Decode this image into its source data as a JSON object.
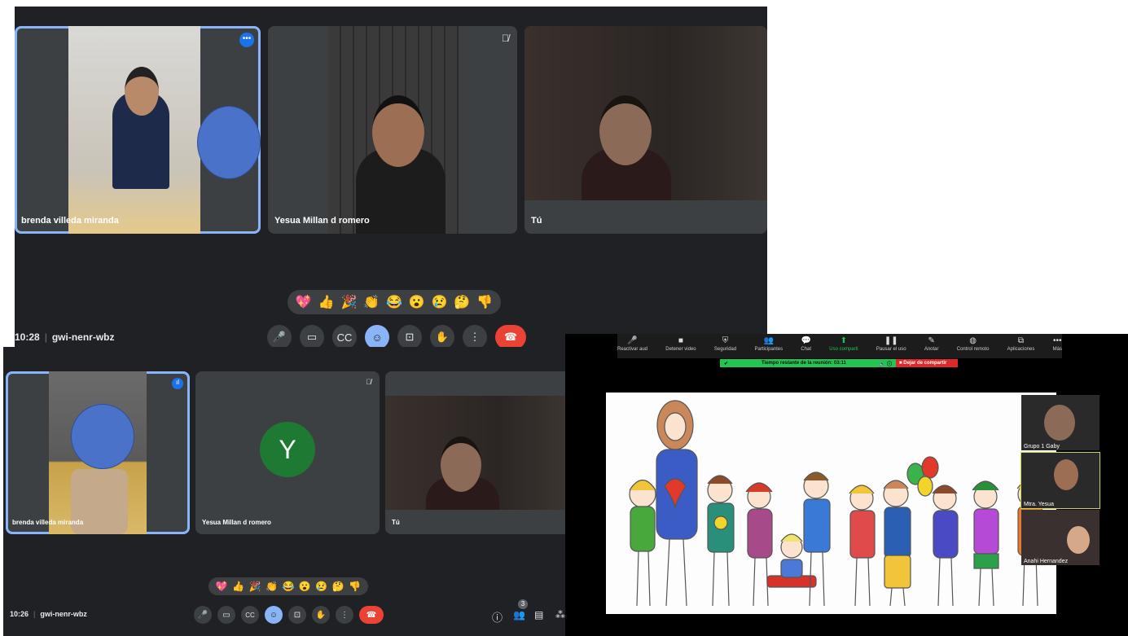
{
  "meet_top": {
    "meeting_time": "10:28",
    "meeting_code": "gwi-nenr-wbz",
    "participants": [
      {
        "name": "brenda villeda miranda"
      },
      {
        "name": "Yesua Millan d romero"
      },
      {
        "name": "Tú"
      }
    ],
    "emojis": [
      "💖",
      "👍",
      "🎉",
      "👏",
      "😂",
      "😮",
      "😢",
      "🤔",
      "👎"
    ]
  },
  "meet_bottom": {
    "meeting_time": "10:26",
    "meeting_code": "gwi-nenr-wbz",
    "participants": [
      {
        "name": "brenda villeda miranda"
      },
      {
        "name": "Yesua Millan d romero",
        "initial": "Y"
      },
      {
        "name": "Tú"
      }
    ],
    "people_count": "3",
    "emojis": [
      "💖",
      "👍",
      "🎉",
      "👏",
      "😂",
      "😮",
      "😢",
      "🤔",
      "👎"
    ]
  },
  "zoom": {
    "toolbar": [
      {
        "label": "Reactivar aud",
        "icon": "mic-muted-icon"
      },
      {
        "label": "Detener video",
        "icon": "video-icon"
      },
      {
        "label": "Seguridad",
        "icon": "shield-icon"
      },
      {
        "label": "Participantes",
        "icon": "participants-icon",
        "count": "3"
      },
      {
        "label": "Chat",
        "icon": "chat-icon"
      },
      {
        "label": "Uso comparti",
        "icon": "share-icon"
      },
      {
        "label": "Pausar el uso",
        "icon": "pause-icon"
      },
      {
        "label": "Anotar",
        "icon": "pencil-icon"
      },
      {
        "label": "Control remoto",
        "icon": "mouse-icon"
      },
      {
        "label": "Aplicaciones",
        "icon": "apps-icon"
      },
      {
        "label": "Más",
        "icon": "more-icon"
      }
    ],
    "status_text": "Tiempo restante de la reunión: 03:11",
    "stop_share_label": "Dejar de compartir",
    "thumbnails": [
      {
        "name": "Grupo 1 Gaby"
      },
      {
        "name": "Mtra. Yesua"
      },
      {
        "name": "Anahi Hernandez"
      }
    ]
  },
  "colors": {
    "meet_bg": "#202124",
    "tile_bg": "#3c4043",
    "active_outline": "#8ab4f8",
    "end_call": "#ea4335",
    "zoom_status_green": "#23c552",
    "zoom_stop_red": "#e02828"
  }
}
